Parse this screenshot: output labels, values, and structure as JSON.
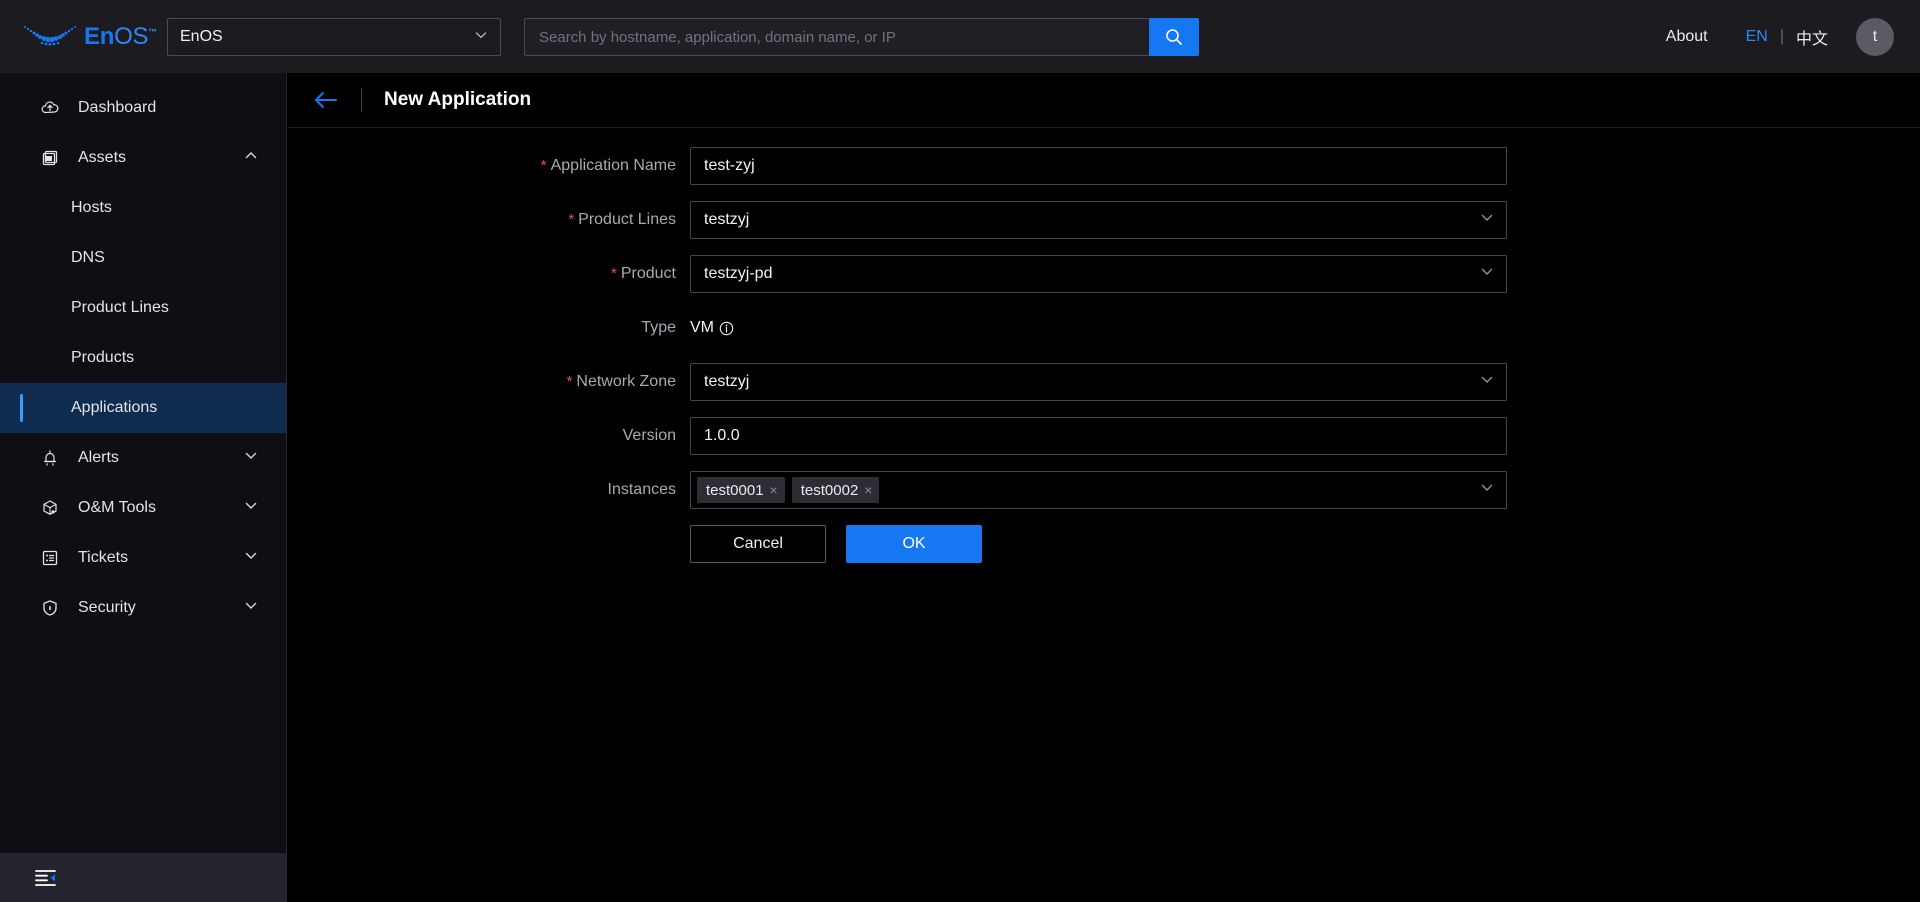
{
  "topbar": {
    "logo_text_bold": "En",
    "logo_text_light": "OS",
    "logo_tm": "™",
    "app_selector": {
      "value": "EnOS",
      "icon": "chevron-down-icon"
    },
    "search": {
      "value": "",
      "placeholder": "Search by hostname, application, domain name, or IP",
      "button_icon": "search-icon"
    },
    "about_label": "About",
    "lang_en": "EN",
    "lang_divider": "|",
    "lang_cn": "中文",
    "avatar_initial": "t"
  },
  "sidebar": {
    "items": [
      {
        "label": "Dashboard",
        "icon": "dashboard-cloud-icon",
        "expandable": false,
        "active": false
      },
      {
        "label": "Assets",
        "icon": "assets-window-icon",
        "expandable": true,
        "expanded": true,
        "chevron": "chevron-up-icon"
      },
      {
        "label": "Alerts",
        "icon": "alerts-bell-icon",
        "expandable": true,
        "expanded": false,
        "chevron": "chevron-down-icon"
      },
      {
        "label": "O&M Tools",
        "icon": "cube-tools-icon",
        "expandable": true,
        "expanded": false,
        "chevron": "chevron-down-icon"
      },
      {
        "label": "Tickets",
        "icon": "ticket-list-icon",
        "expandable": true,
        "expanded": false,
        "chevron": "chevron-down-icon"
      },
      {
        "label": "Security",
        "icon": "shield-icon",
        "expandable": true,
        "expanded": false,
        "chevron": "chevron-down-icon"
      }
    ],
    "assets_children": [
      {
        "label": "Hosts",
        "active": false
      },
      {
        "label": "DNS",
        "active": false
      },
      {
        "label": "Product Lines",
        "active": false
      },
      {
        "label": "Products",
        "active": false
      },
      {
        "label": "Applications",
        "active": true
      }
    ],
    "footer": {
      "icon": "collapse-sidebar-icon"
    }
  },
  "page": {
    "back_icon": "back-arrow-icon",
    "title": "New Application"
  },
  "form": {
    "fields": [
      {
        "label": "Application Name",
        "required": true,
        "type": "text",
        "value": "test-zyj",
        "name": "application-name-input"
      },
      {
        "label": "Product Lines",
        "required": true,
        "type": "select",
        "value": "testzyj",
        "name": "product-lines-select"
      },
      {
        "label": "Product",
        "required": true,
        "type": "select",
        "value": "testzyj-pd",
        "name": "product-select"
      },
      {
        "label": "Type",
        "required": false,
        "type": "static",
        "value": "VM",
        "info_icon": "info-circle-icon",
        "name": "type-value"
      },
      {
        "label": "Network Zone",
        "required": true,
        "type": "select",
        "value": "testzyj",
        "name": "network-zone-select"
      },
      {
        "label": "Version",
        "required": false,
        "type": "text",
        "value": "1.0.0",
        "name": "version-input"
      },
      {
        "label": "Instances",
        "required": false,
        "type": "tags",
        "tags": [
          "test0001",
          "test0002"
        ],
        "tag_remove": "×",
        "name": "instances-multiselect"
      }
    ],
    "buttons": {
      "cancel": "Cancel",
      "ok": "OK"
    }
  },
  "colors": {
    "accent": "#1677f2",
    "accent_light": "#2f86f5",
    "required_star": "#e0525f",
    "sidebar_active_bg": "#0f2b4f",
    "sidebar_active_bar": "#3b9bff",
    "topbar_bg": "#1c1c20",
    "sidebar_bg": "#0e0e13",
    "main_bg": "#000000"
  }
}
